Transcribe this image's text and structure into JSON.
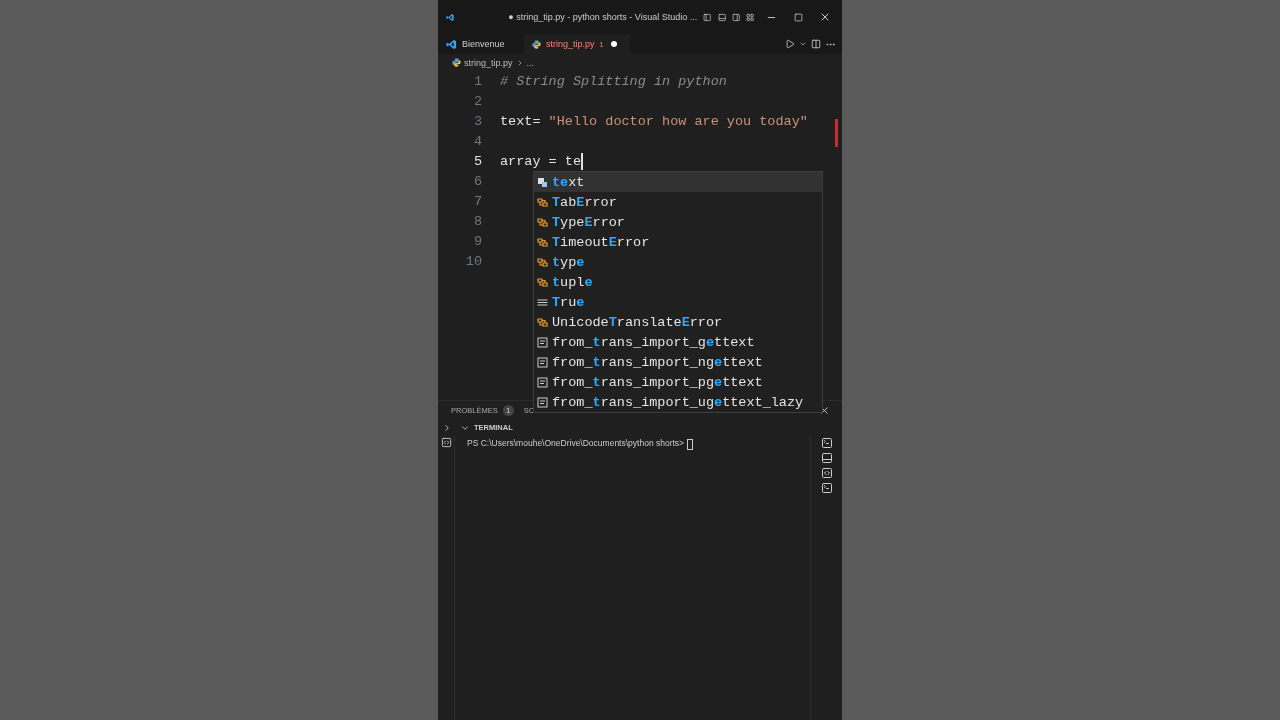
{
  "window": {
    "title": "● string_tip.py - python shorts - Visual Studio ..."
  },
  "tabs": [
    {
      "label": "Bienvenue",
      "selected": false,
      "modified": false
    },
    {
      "label": "string_tip.py",
      "selected": true,
      "problems": "1",
      "modified": true
    }
  ],
  "breadcrumb": {
    "file": "string_tip.py",
    "rest": "..."
  },
  "editor": {
    "lines": [
      {
        "number": "1",
        "selected": false,
        "cursor": false,
        "tokens": [
          {
            "kind": "comment",
            "text": "# String Splitting in python"
          }
        ]
      },
      {
        "number": "2",
        "selected": false,
        "cursor": false
      },
      {
        "number": "3",
        "selected": false,
        "cursor": false,
        "tokens": [
          {
            "kind": "plain",
            "text": "text= "
          },
          {
            "kind": "string",
            "text": "\"Hello doctor how are you today\""
          }
        ]
      },
      {
        "number": "4",
        "selected": false,
        "cursor": false
      },
      {
        "number": "5",
        "selected": true,
        "cursor": true,
        "tokens": [
          {
            "kind": "plain",
            "text": "array = te"
          }
        ]
      },
      {
        "number": "6",
        "selected": false,
        "cursor": false
      },
      {
        "number": "7",
        "selected": false,
        "cursor": false
      },
      {
        "number": "8",
        "selected": false,
        "cursor": false
      },
      {
        "number": "9",
        "selected": false,
        "cursor": false
      },
      {
        "number": "10",
        "selected": false,
        "cursor": false
      }
    ]
  },
  "suggestions": [
    {
      "kind": "variable",
      "selected": true,
      "parts": [
        {
          "text": "te",
          "match": true
        },
        {
          "text": "xt",
          "match": false
        }
      ]
    },
    {
      "kind": "class",
      "selected": false,
      "parts": [
        {
          "text": "T",
          "match": true
        },
        {
          "text": "ab",
          "match": false
        },
        {
          "text": "E",
          "match": true
        },
        {
          "text": "rror",
          "match": false
        }
      ]
    },
    {
      "kind": "class",
      "selected": false,
      "parts": [
        {
          "text": "T",
          "match": true
        },
        {
          "text": "ype",
          "match": false
        },
        {
          "text": "E",
          "match": true
        },
        {
          "text": "rror",
          "match": false
        }
      ]
    },
    {
      "kind": "class",
      "selected": false,
      "parts": [
        {
          "text": "T",
          "match": true
        },
        {
          "text": "imeout",
          "match": false
        },
        {
          "text": "E",
          "match": true
        },
        {
          "text": "rror",
          "match": false
        }
      ]
    },
    {
      "kind": "class",
      "selected": false,
      "parts": [
        {
          "text": "t",
          "match": true
        },
        {
          "text": "yp",
          "match": false
        },
        {
          "text": "e",
          "match": true
        }
      ]
    },
    {
      "kind": "class",
      "selected": false,
      "parts": [
        {
          "text": "t",
          "match": true
        },
        {
          "text": "upl",
          "match": false
        },
        {
          "text": "e",
          "match": true
        }
      ]
    },
    {
      "kind": "constant",
      "selected": false,
      "parts": [
        {
          "text": "T",
          "match": true
        },
        {
          "text": "ru",
          "match": false
        },
        {
          "text": "e",
          "match": true
        }
      ]
    },
    {
      "kind": "class",
      "selected": false,
      "parts": [
        {
          "text": "Unicode",
          "match": false
        },
        {
          "text": "T",
          "match": true
        },
        {
          "text": "ranslate",
          "match": false
        },
        {
          "text": "E",
          "match": true
        },
        {
          "text": "rror",
          "match": false
        }
      ]
    },
    {
      "kind": "snippet",
      "selected": false,
      "parts": [
        {
          "text": "from_",
          "match": false
        },
        {
          "text": "t",
          "match": true
        },
        {
          "text": "rans_import_g",
          "match": false
        },
        {
          "text": "e",
          "match": true
        },
        {
          "text": "ttext",
          "match": false
        }
      ]
    },
    {
      "kind": "snippet",
      "selected": false,
      "parts": [
        {
          "text": "from_",
          "match": false
        },
        {
          "text": "t",
          "match": true
        },
        {
          "text": "rans_import_ng",
          "match": false
        },
        {
          "text": "e",
          "match": true
        },
        {
          "text": "ttext",
          "match": false
        }
      ]
    },
    {
      "kind": "snippet",
      "selected": false,
      "parts": [
        {
          "text": "from_",
          "match": false
        },
        {
          "text": "t",
          "match": true
        },
        {
          "text": "rans_import_pg",
          "match": false
        },
        {
          "text": "e",
          "match": true
        },
        {
          "text": "ttext",
          "match": false
        }
      ]
    },
    {
      "kind": "snippet",
      "selected": false,
      "parts": [
        {
          "text": "from_",
          "match": false
        },
        {
          "text": "t",
          "match": true
        },
        {
          "text": "rans_import_ug",
          "match": false
        },
        {
          "text": "e",
          "match": true
        },
        {
          "text": "ttext_lazy",
          "match": false
        }
      ]
    }
  ],
  "panel": {
    "tabs": [
      {
        "label": "PROBLÈMES",
        "badge": "1"
      },
      {
        "label": "SC"
      }
    ],
    "terminal": {
      "title": "TERMINAL",
      "expanded": true,
      "prompt": "PS C:\\Users\\mouhe\\OneDrive\\Documents\\python shorts>"
    }
  }
}
